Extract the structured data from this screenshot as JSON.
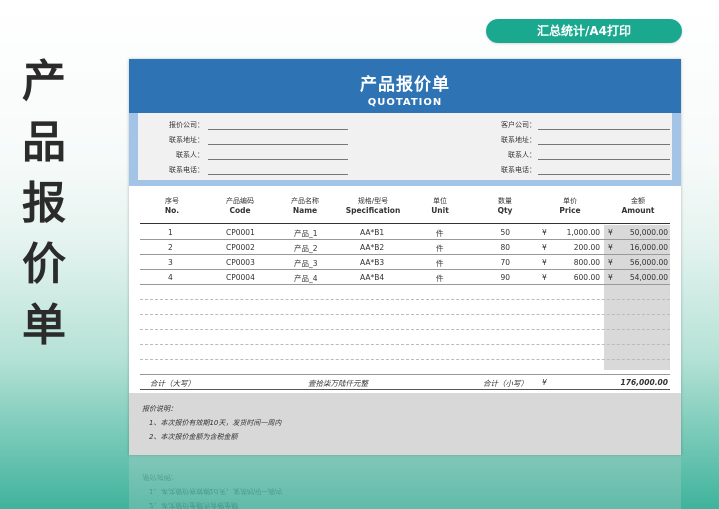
{
  "top_button": "汇总统计/A4打印",
  "side_title": [
    "产",
    "品",
    "报",
    "价",
    "单"
  ],
  "sheet": {
    "title_cn": "产品报价单",
    "title_en": "QUOTATION",
    "info_left": [
      "报价公司：",
      "联系地址：",
      "联系人：",
      "联系电话："
    ],
    "info_right": [
      "客户公司：",
      "联系地址：",
      "联系人：",
      "联系电话："
    ],
    "headers_cn": [
      "序号",
      "产品编码",
      "产品名称",
      "规格/型号",
      "单位",
      "数量",
      "单价",
      "金额"
    ],
    "headers_en": [
      "No.",
      "Code",
      "Name",
      "Specification",
      "Unit",
      "Qty",
      "Price",
      "Amount"
    ],
    "currency": "¥",
    "rows": [
      {
        "no": "1",
        "code": "CP0001",
        "name": "产品_1",
        "spec": "AA*B1",
        "unit": "件",
        "qty": "50",
        "price": "1,000.00",
        "amount": "50,000.00"
      },
      {
        "no": "2",
        "code": "CP0002",
        "name": "产品_2",
        "spec": "AA*B2",
        "unit": "件",
        "qty": "80",
        "price": "200.00",
        "amount": "16,000.00"
      },
      {
        "no": "3",
        "code": "CP0003",
        "name": "产品_3",
        "spec": "AA*B3",
        "unit": "件",
        "qty": "70",
        "price": "800.00",
        "amount": "56,000.00"
      },
      {
        "no": "4",
        "code": "CP0004",
        "name": "产品_4",
        "spec": "AA*B4",
        "unit": "件",
        "qty": "90",
        "price": "600.00",
        "amount": "54,000.00"
      }
    ],
    "total_label_upper": "合计（大写）",
    "total_upper": "壹拾柒万陆仟元整",
    "total_label_lower": "合计（小写）",
    "total_lower": "176,000.00",
    "notes_title": "报价说明：",
    "notes": [
      "1、本次报价有效期10天，发货时间一周内",
      "2、本次报价金额为含税金额"
    ]
  },
  "colors": {
    "accent": "#1aa98f",
    "header_blue": "#2e74b5",
    "info_border": "#a3c4e6"
  }
}
